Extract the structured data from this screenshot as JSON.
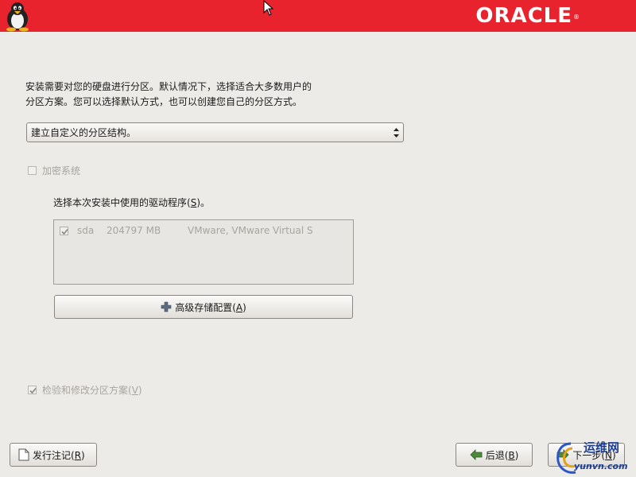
{
  "header": {
    "brand": "ORACLE",
    "brand_mark": "®"
  },
  "description": {
    "line1": "安装需要对您的硬盘进行分区。默认情况下，选择适合大多数用户的",
    "line2": "分区方案。您可以选择默认方式，也可以创建您自己的分区方式。"
  },
  "layout_select": {
    "value": "建立自定义的分区结构。"
  },
  "encrypt": {
    "label": "加密系统",
    "checked": false
  },
  "drivers": {
    "label_prefix": "选择本次安装中使用的驱动程序(",
    "label_key": "S",
    "label_suffix": ")。",
    "rows": [
      {
        "name": "sda",
        "size": "204797 MB",
        "model": "VMware, VMware Virtual S",
        "checked": true
      }
    ]
  },
  "advanced_button": {
    "prefix": "高级存储配置(",
    "key": "A",
    "suffix": ")"
  },
  "review": {
    "prefix": "检验和修改分区方案(",
    "key": "V",
    "suffix": ")",
    "checked": true
  },
  "footer": {
    "notes_prefix": "发行注记(",
    "notes_key": "R",
    "notes_suffix": ")",
    "back_prefix": "后退(",
    "back_key": "B",
    "back_suffix": ")",
    "next_prefix": "下一步(",
    "next_key": "N",
    "next_suffix": ")"
  },
  "watermark": {
    "line1": "运维网",
    "line2": "yunvn.com"
  },
  "colors": {
    "banner": "#e8232d",
    "background": "#edebe7"
  }
}
